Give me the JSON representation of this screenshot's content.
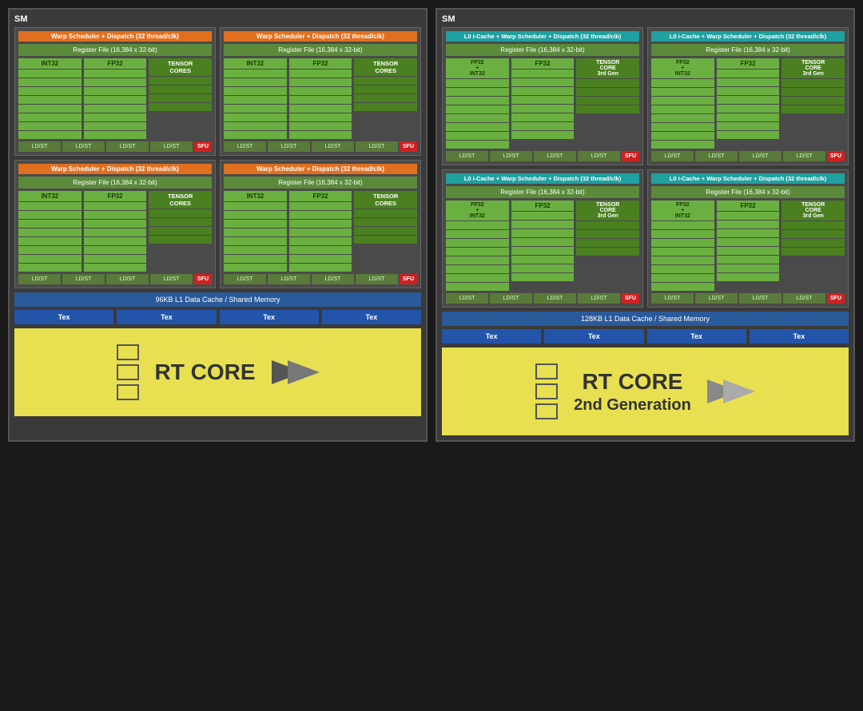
{
  "left_sm": {
    "label": "SM",
    "warp_header": "Warp Scheduler + Dispatch (32 thread/clk)",
    "reg_file": "Register File (16,384 x 32-bit)",
    "int32": "INT32",
    "fp32": "FP32",
    "tensor": "TENSOR\nCORES",
    "ldst": "LD/ST",
    "sfu": "SFU",
    "l1_cache": "96KB L1 Data Cache / Shared Memory",
    "tex": "Tex",
    "rt_core": "RT CORE"
  },
  "right_sm": {
    "label": "SM",
    "warp_header_teal": "L0 i-Cache + Warp Scheduler + Dispatch (32 thread/clk)",
    "reg_file": "Register File (16,384 x 32-bit)",
    "fp32int32": "FP32\n+\nINT32",
    "fp32": "FP32",
    "tensor": "TENSOR\nCORE\n3rd Gen",
    "ldst": "LD/ST",
    "sfu": "SFU",
    "l1_cache": "128KB L1 Data Cache / Shared Memory",
    "tex": "Tex",
    "rt_core": "RT CORE",
    "rt_core_gen": "2nd Generation"
  }
}
